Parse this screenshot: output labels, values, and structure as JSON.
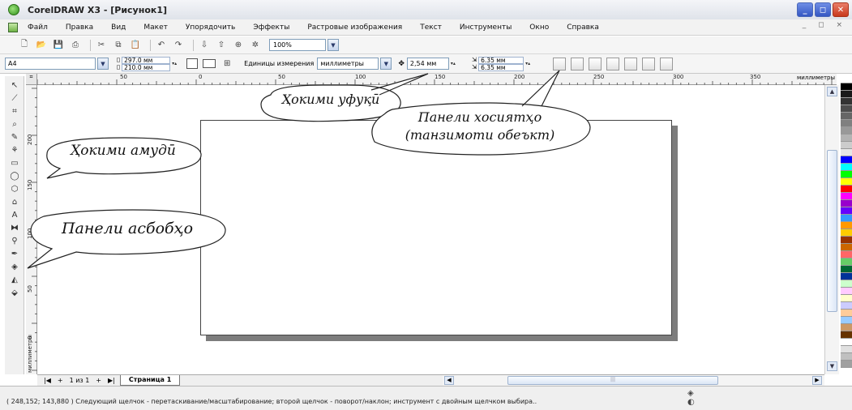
{
  "window": {
    "title": "CorelDRAW X3 - [Рисунок1]",
    "controls": [
      "_",
      "◻",
      "✕"
    ]
  },
  "menu": {
    "items": [
      "Файл",
      "Правка",
      "Вид",
      "Макет",
      "Упорядочить",
      "Эффекты",
      "Растровые изображения",
      "Текст",
      "Инструменты",
      "Окно",
      "Справка"
    ],
    "right_controls": "_ ◻ ×"
  },
  "standard_toolbar": {
    "zoom": "100%"
  },
  "property_bar": {
    "page_size": "A4",
    "width": "297.0 мм",
    "height": "210.0 мм",
    "units_label": "Единицы измерения",
    "units_value": "миллиметры",
    "nudge": "2,54 мм",
    "dup_x": "6.35 мм",
    "dup_y": "6.35 мм"
  },
  "ruler": {
    "top_labels": [
      "50",
      "0",
      "50",
      "100",
      "150",
      "200",
      "250",
      "300",
      "350"
    ],
    "left_labels": [
      "200",
      "150",
      "100",
      "50",
      "0"
    ],
    "units": "миллиметры",
    "left_units": "миллиметры"
  },
  "page_nav": {
    "counter": "1 из 1",
    "tab_label": "Страница 1"
  },
  "status": {
    "text": "( 248,152; 143,880 )   Следующий щелчок - перетаскивание/масштабирование; второй щелчок - поворот/наклон; инструмент с двойным щелчком выбира.."
  },
  "callouts": {
    "horizontal_ruler": "Ҳокими уфуқӣ",
    "vertical_ruler": "Ҳокими амудӣ",
    "toolbox": "Панели асбобҳо",
    "property_bar_line1": "Панели хосиятҳо",
    "property_bar_line2": "(танзимоти обеъкт)"
  },
  "palette_colors": [
    "#ffffff",
    "#000000",
    "#1a1a1a",
    "#333333",
    "#4d4d4d",
    "#666666",
    "#808080",
    "#999999",
    "#b3b3b3",
    "#cccccc",
    "#e6e6e6",
    "#0000ff",
    "#00ffff",
    "#00ff00",
    "#ffff00",
    "#ff0000",
    "#ff00ff",
    "#9900cc",
    "#6600ff",
    "#3399ff",
    "#ff9900",
    "#ffcc00",
    "#993300",
    "#cc6600",
    "#ff6666",
    "#66cc66",
    "#006633",
    "#003399",
    "#ccffcc",
    "#ffccff",
    "#ffffcc",
    "#ccccff",
    "#ffcc99",
    "#99ccff",
    "#cc9966",
    "#663300",
    "#ffffff",
    "#e0e0e0",
    "#c0c0c0",
    "#a0a0a0"
  ]
}
